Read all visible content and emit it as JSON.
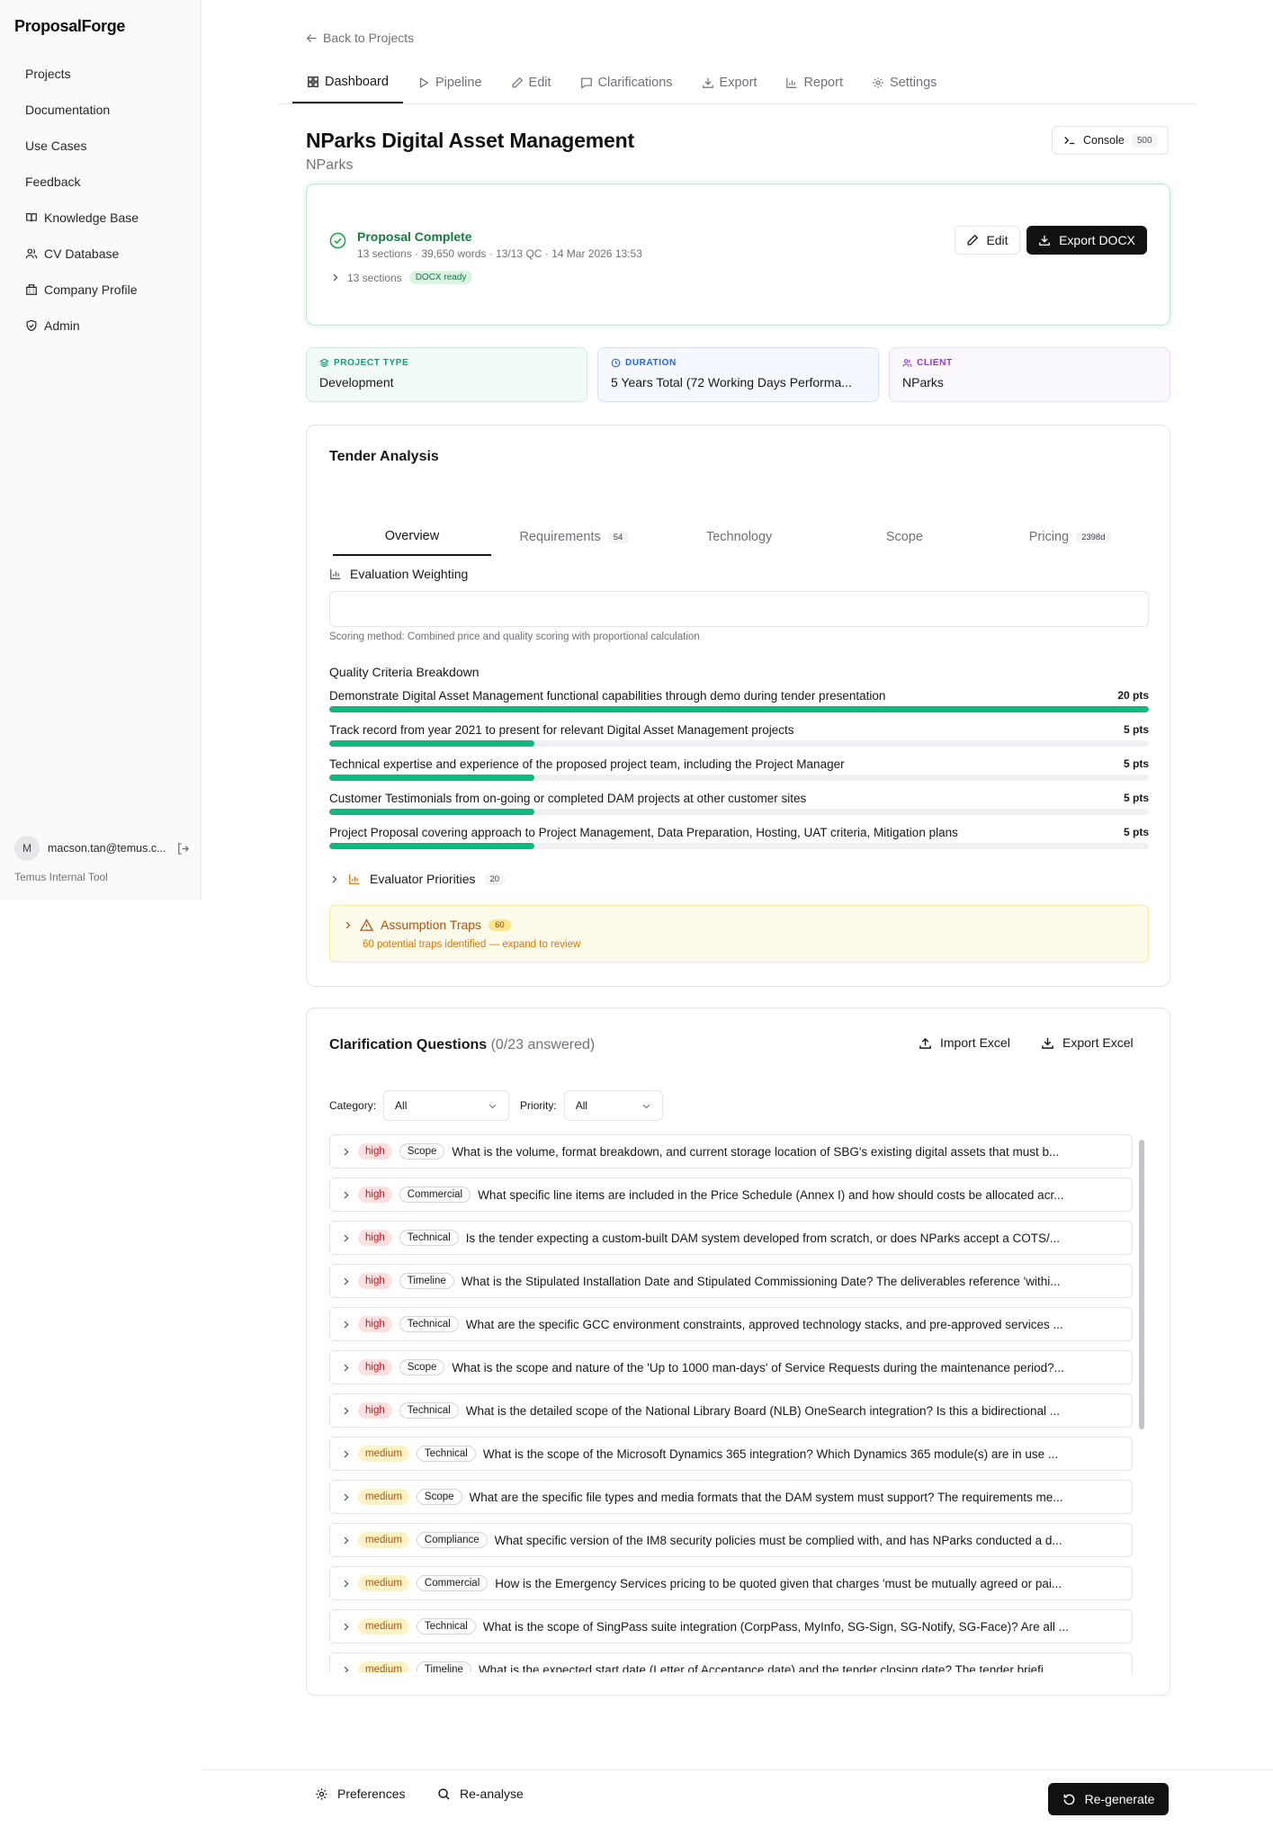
{
  "app": {
    "brand": "ProposalForge",
    "tool_label": "Temus Internal Tool"
  },
  "sidebar": {
    "items": [
      {
        "label": "Projects",
        "icon": ""
      },
      {
        "label": "Documentation",
        "icon": ""
      },
      {
        "label": "Use Cases",
        "icon": ""
      },
      {
        "label": "Feedback",
        "icon": ""
      },
      {
        "label": "Knowledge Base",
        "icon": "book-icon"
      },
      {
        "label": "CV Database",
        "icon": "users-icon"
      },
      {
        "label": "Company Profile",
        "icon": "building-icon"
      },
      {
        "label": "Admin",
        "icon": "shield-icon"
      }
    ],
    "user": {
      "initial": "M",
      "email": "macson.tan@temus.c..."
    }
  },
  "header": {
    "back_label": "Back to Projects",
    "tabs": [
      {
        "label": "Dashboard",
        "icon": "grid-icon"
      },
      {
        "label": "Pipeline",
        "icon": "play-icon"
      },
      {
        "label": "Edit",
        "icon": "pencil-icon"
      },
      {
        "label": "Clarifications",
        "icon": "message-icon"
      },
      {
        "label": "Export",
        "icon": "download-icon"
      },
      {
        "label": "Report",
        "icon": "chart-icon"
      },
      {
        "label": "Settings",
        "icon": "gear-icon"
      }
    ],
    "active_tab": "Dashboard"
  },
  "project": {
    "title": "NParks Digital Asset Management",
    "client": "NParks",
    "console_label": "Console",
    "console_count": "500"
  },
  "status": {
    "title": "Proposal Complete",
    "meta": "13 sections · 39,650 words · 13/13 QC · 14 Mar 2026 13:53",
    "sections_label": "13 sections",
    "badge": "DOCX ready",
    "edit_label": "Edit",
    "export_label": "Export DOCX",
    "colors": {
      "success": "#167a40",
      "border": "#bfe6cf"
    }
  },
  "info_cards": [
    {
      "label": "PROJECT TYPE",
      "value": "Development",
      "icon": "layers-icon",
      "color": "#0f9d76",
      "bg": "#f3fbf8",
      "border": "#c9ecdf"
    },
    {
      "label": "DURATION",
      "value": "5 Years Total (72 Working Days Performa...",
      "icon": "clock-icon",
      "color": "#2563eb",
      "bg": "#f5f8ff",
      "border": "#d4e0fb"
    },
    {
      "label": "CLIENT",
      "value": "NParks",
      "icon": "users-icon",
      "color": "#9333ea",
      "bg": "#fbf7ff",
      "border": "#eadcf8"
    }
  ],
  "tender": {
    "title": "Tender Analysis",
    "tabs": [
      {
        "label": "Overview",
        "count": ""
      },
      {
        "label": "Requirements",
        "count": "54"
      },
      {
        "label": "Technology",
        "count": ""
      },
      {
        "label": "Scope",
        "count": ""
      },
      {
        "label": "Pricing",
        "count": "2398d"
      }
    ],
    "evaluation_label": "Evaluation Weighting",
    "scoring_method": "Scoring method: Combined price and quality scoring with proportional calculation",
    "quality_label": "Quality Criteria Breakdown",
    "criteria": [
      {
        "label": "Demonstrate Digital Asset Management functional capabilities through demo during tender presentation",
        "points": "20 pts",
        "fraction": 1.0
      },
      {
        "label": "Track record from year 2021 to present for relevant Digital Asset Management projects",
        "points": "5 pts",
        "fraction": 0.25
      },
      {
        "label": "Technical expertise and experience of the proposed project team, including the Project Manager",
        "points": "5 pts",
        "fraction": 0.25
      },
      {
        "label": "Customer Testimonials from on-going or completed DAM projects at other customer sites",
        "points": "5 pts",
        "fraction": 0.25
      },
      {
        "label": "Project Proposal covering approach to Project Management, Data Preparation, Hosting, UAT criteria, Mitigation plans",
        "points": "5 pts",
        "fraction": 0.25
      }
    ],
    "evaluator_label": "Evaluator Priorities",
    "evaluator_count": "20",
    "traps_label": "Assumption Traps",
    "traps_count": "60",
    "traps_sub": "60 potential traps identified — expand to review"
  },
  "clarifications": {
    "title": "Clarification Questions",
    "answered": "(0/23 answered)",
    "import_label": "Import Excel",
    "export_label": "Export Excel",
    "category_label": "Category:",
    "category_value": "All",
    "priority_label": "Priority:",
    "priority_value": "All",
    "questions": [
      {
        "priority": "high",
        "category": "Scope",
        "text": "What is the volume, format breakdown, and current storage location of SBG's existing digital assets that must b..."
      },
      {
        "priority": "high",
        "category": "Commercial",
        "text": "What specific line items are included in the Price Schedule (Annex I) and how should costs be allocated acr..."
      },
      {
        "priority": "high",
        "category": "Technical",
        "text": "Is the tender expecting a custom-built DAM system developed from scratch, or does NParks accept a COTS/..."
      },
      {
        "priority": "high",
        "category": "Timeline",
        "text": "What is the Stipulated Installation Date and Stipulated Commissioning Date? The deliverables reference 'withi..."
      },
      {
        "priority": "high",
        "category": "Technical",
        "text": "What are the specific GCC environment constraints, approved technology stacks, and pre-approved services ..."
      },
      {
        "priority": "high",
        "category": "Scope",
        "text": "What is the scope and nature of the 'Up to 1000 man-days' of Service Requests during the maintenance period?..."
      },
      {
        "priority": "high",
        "category": "Technical",
        "text": "What is the detailed scope of the National Library Board (NLB) OneSearch integration? Is this a bidirectional ..."
      },
      {
        "priority": "medium",
        "category": "Technical",
        "text": "What is the scope of the Microsoft Dynamics 365 integration? Which Dynamics 365 module(s) are in use ..."
      },
      {
        "priority": "medium",
        "category": "Scope",
        "text": "What are the specific file types and media formats that the DAM system must support? The requirements me..."
      },
      {
        "priority": "medium",
        "category": "Compliance",
        "text": "What specific version of the IM8 security policies must be complied with, and has NParks conducted a d..."
      },
      {
        "priority": "medium",
        "category": "Commercial",
        "text": "How is the Emergency Services pricing to be quoted given that charges 'must be mutually agreed or pai..."
      },
      {
        "priority": "medium",
        "category": "Technical",
        "text": "What is the scope of SingPass suite integration (CorpPass, MyInfo, SG-Sign, SG-Notify, SG-Face)? Are all ..."
      },
      {
        "priority": "medium",
        "category": "Timeline",
        "text": "What is the expected start date (Letter of Acceptance date) and the tender closing date? The tender briefi..."
      }
    ]
  },
  "footer": {
    "preferences_label": "Preferences",
    "reanalyse_label": "Re-analyse",
    "regenerate_label": "Re-generate"
  }
}
